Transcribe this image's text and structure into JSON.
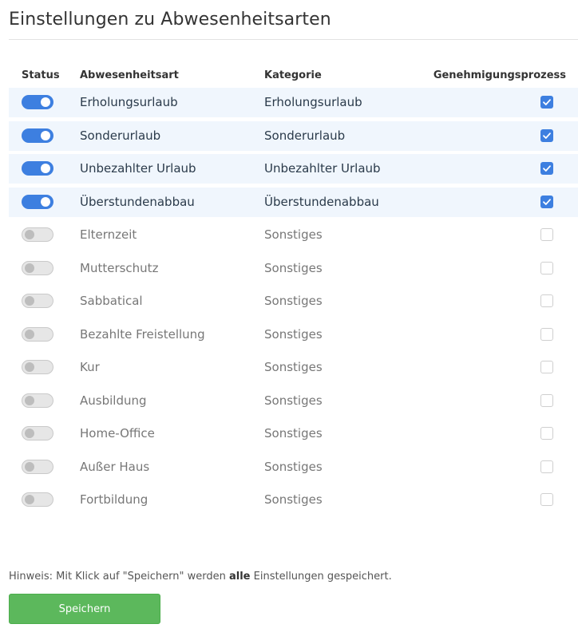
{
  "page": {
    "title": "Einstellungen zu Abwesenheitsarten"
  },
  "table": {
    "headers": {
      "status": "Status",
      "name": "Abwesenheitsart",
      "category": "Kategorie",
      "approval": "Genehmigungsprozess"
    },
    "rows": [
      {
        "enabled": true,
        "name": "Erholungsurlaub",
        "category": "Erholungsurlaub",
        "approval": true
      },
      {
        "enabled": true,
        "name": "Sonderurlaub",
        "category": "Sonderurlaub",
        "approval": true
      },
      {
        "enabled": true,
        "name": "Unbezahlter Urlaub",
        "category": "Unbezahlter Urlaub",
        "approval": true
      },
      {
        "enabled": true,
        "name": "Überstundenabbau",
        "category": "Überstundenabbau",
        "approval": true
      },
      {
        "enabled": false,
        "name": "Elternzeit",
        "category": "Sonstiges",
        "approval": false
      },
      {
        "enabled": false,
        "name": "Mutterschutz",
        "category": "Sonstiges",
        "approval": false
      },
      {
        "enabled": false,
        "name": "Sabbatical",
        "category": "Sonstiges",
        "approval": false
      },
      {
        "enabled": false,
        "name": "Bezahlte Freistellung",
        "category": "Sonstiges",
        "approval": false
      },
      {
        "enabled": false,
        "name": "Kur",
        "category": "Sonstiges",
        "approval": false
      },
      {
        "enabled": false,
        "name": "Ausbildung",
        "category": "Sonstiges",
        "approval": false
      },
      {
        "enabled": false,
        "name": "Home-Office",
        "category": "Sonstiges",
        "approval": false
      },
      {
        "enabled": false,
        "name": "Außer Haus",
        "category": "Sonstiges",
        "approval": false
      },
      {
        "enabled": false,
        "name": "Fortbildung",
        "category": "Sonstiges",
        "approval": false
      }
    ]
  },
  "footer": {
    "note_prefix": "Hinweis: Mit Klick auf \"Speichern\" werden ",
    "note_bold": "alle",
    "note_suffix": " Einstellungen gespeichert.",
    "save_label": "Speichern"
  },
  "colors": {
    "accent": "#3d7fe0",
    "save_button": "#5cb85c",
    "active_row": "#f0f6fd"
  }
}
